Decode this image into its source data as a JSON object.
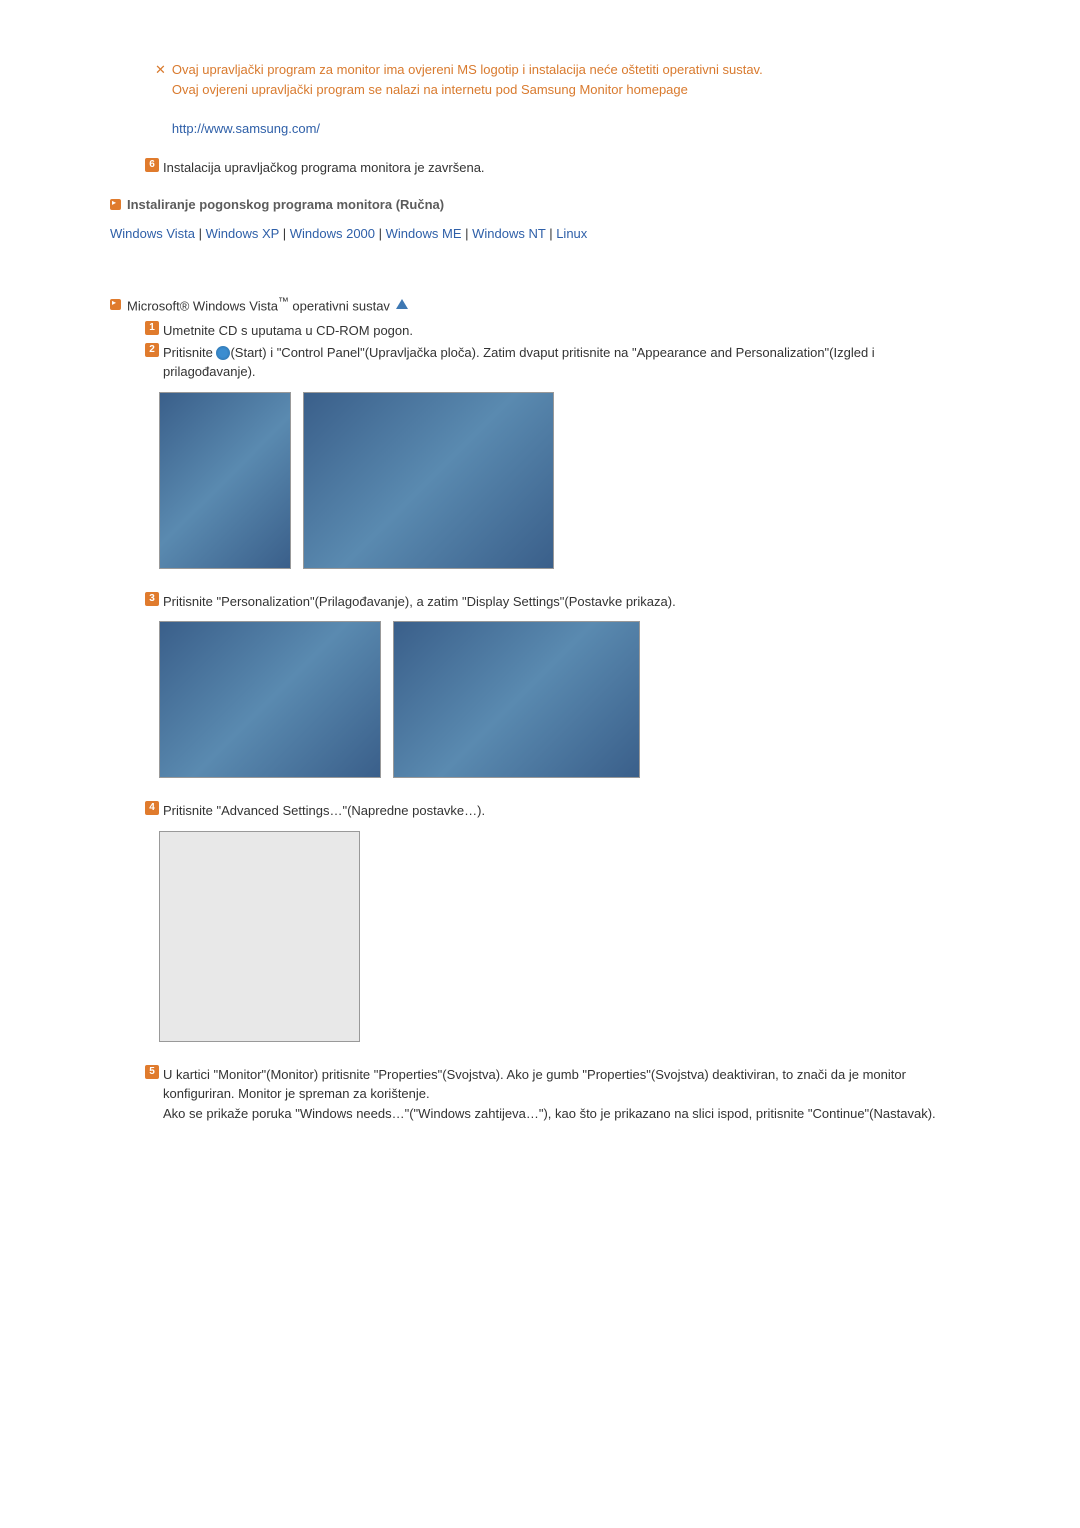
{
  "note": {
    "line1a": "Ovaj upravljački program za monitor ima ovjereni MS logotip i instalacija neće oštetiti operativni sustav.",
    "line1b_prefix": "Ovaj ovjereni upravljački program se nalazi na internetu pod ",
    "line1b_link": "Samsung Monitor homepage",
    "url": "http://www.samsung.com/"
  },
  "step6": "Instalacija upravljačkog programa monitora je završena.",
  "heading": "Instaliranje pogonskog programa monitora (Ručna)",
  "os_links": {
    "vista": "Windows Vista",
    "xp": "Windows XP",
    "w2000": "Windows 2000",
    "me": "Windows ME",
    "nt": "Windows NT",
    "linux": "Linux"
  },
  "vista_title_prefix": "Microsoft® Windows Vista",
  "vista_title_suffix": " operativni sustav",
  "steps": {
    "s1": "Umetnite CD s uputama u CD-ROM pogon.",
    "s2a": "Pritisnite ",
    "s2b": "(Start) i \"Control Panel\"(Upravljačka ploča). Zatim dvaput pritisnite na \"Appearance and Personalization\"(Izgled i prilagođavanje).",
    "s3": "Pritisnite \"Personalization\"(Prilagođavanje), a zatim \"Display Settings\"(Postavke prikaza).",
    "s4": "Pritisnite \"Advanced Settings…\"(Napredne postavke…).",
    "s5a": "U kartici \"Monitor\"(Monitor) pritisnite \"Properties\"(Svojstva). Ako je gumb \"Properties\"(Svojstva) deaktiviran, to znači da je monitor konfiguriran. Monitor je spreman za korištenje.",
    "s5b": "Ako se prikaže poruka \"Windows needs…\"(\"Windows zahtijeva…\"), kao što je prikazano na slici ispod, pritisnite \"Continue\"(Nastavak)."
  }
}
